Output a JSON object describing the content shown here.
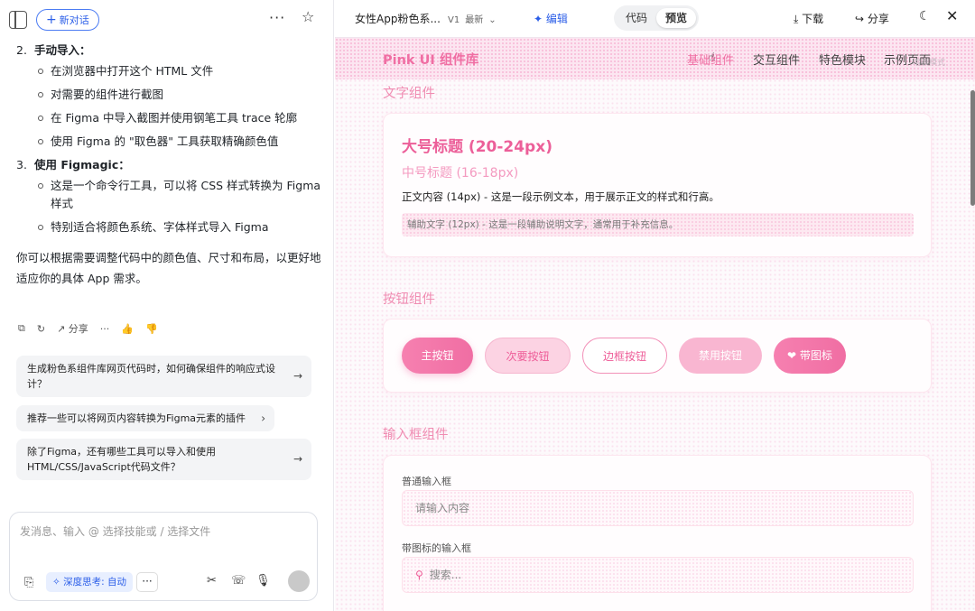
{
  "left_panel": {
    "new_chat_label": "新对话",
    "more_label": "···",
    "steps": [
      {
        "num": "2.",
        "title": "手动导入：",
        "subs": [
          "在浏览器中打开这个 HTML 文件",
          "对需要的组件进行截图",
          "在 Figma 中导入截图并使用钢笔工具 trace 轮廓",
          "使用 Figma 的 \"取色器\" 工具获取精确颜色值"
        ]
      },
      {
        "num": "3.",
        "title": "使用 Figmagic：",
        "subs": [
          "这是一个命令行工具，可以将 CSS 样式转换为 Figma 样式",
          "特别适合将颜色系统、字体样式导入 Figma"
        ]
      }
    ],
    "paragraph": "你可以根据需要调整代码中的颜色值、尺寸和布局，以更好地适应你的具体 App 需求。",
    "share_label": "分享",
    "suggestions": [
      "生成粉色系组件库网页代码时，如何确保组件的响应式设计？",
      "推荐一些可以将网页内容转换为Figma元素的插件",
      "除了Figma，还有哪些工具可以导入和使用HTML/CSS/JavaScript代码文件？"
    ],
    "input_placeholder": "发消息、输入 @ 选择技能或 / 选择文件",
    "deep_think_label": "深度思考: 自动"
  },
  "top_bar": {
    "doc_title": "女性App粉色系...",
    "version": "V1",
    "version_status": "最新",
    "edit_label": "编辑",
    "tabs": [
      "代码",
      "预览"
    ],
    "active_tab": "预览",
    "download_label": "下载",
    "share_label": "分享"
  },
  "preview": {
    "brand": "Pink UI 组件库",
    "nav": [
      "基础组件",
      "交互组件",
      "特色模块",
      "示例页面"
    ],
    "nav_active": "基础组件",
    "ghost_text": "暗夜模式",
    "text_section": {
      "title": "文字组件",
      "large": "大号标题 (20-24px)",
      "medium": "中号标题 (16-18px)",
      "body": "正文内容 (14px) - 这是一段示例文本，用于展示正文的样式和行高。",
      "helper": "辅助文字 (12px) - 这是一段辅助说明文字，通常用于补充信息。"
    },
    "button_section": {
      "title": "按钮组件",
      "buttons": [
        "主按钮",
        "次要按钮",
        "边框按钮",
        "禁用按钮",
        "带图标"
      ]
    },
    "input_section": {
      "title": "输入框组件",
      "normal_label": "普通输入框",
      "normal_placeholder": "请输入内容",
      "icon_label": "带图标的输入框",
      "icon_placeholder": "搜索..."
    }
  },
  "colors": {
    "accent": "#f06ea3",
    "link": "#2b5ee8"
  }
}
